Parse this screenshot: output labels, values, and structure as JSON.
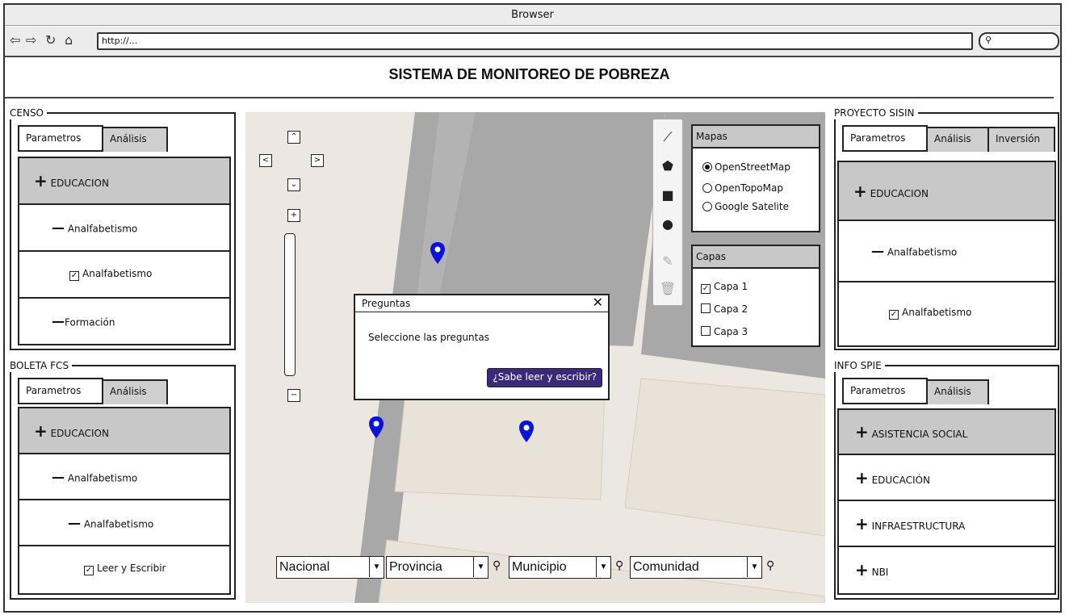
{
  "browser": {
    "title": "Browser",
    "url": "http://..."
  },
  "app_title": "SISTEMA DE MONITOREO DE POBREZA",
  "censo": {
    "label": "CENSO",
    "tabs": [
      "Parametros",
      "Análisis"
    ],
    "items": [
      "EDUCACION",
      "Analfabetismo",
      "Analfabetismo",
      "Formación"
    ]
  },
  "boleta": {
    "label": "BOLETA FCS",
    "tabs": [
      "Parametros",
      "Análisis"
    ],
    "items": [
      "EDUCACION",
      "Analfabetismo",
      "Analfabetismo",
      "Leer y Escribir"
    ]
  },
  "sisin": {
    "label": "PROYECTO SISIN",
    "tabs": [
      "Parametros",
      "Análisis",
      "Inversión"
    ],
    "items": [
      "EDUCACION",
      "Analfabetismo",
      "Analfabetismo"
    ]
  },
  "spie": {
    "label": "INFO SPIE",
    "tabs": [
      "Parametros",
      "Análisis"
    ],
    "items": [
      "ASISTENCIA SOCIAL",
      "EDUCACIÓN",
      "INFRAESTRUCTURA",
      "NBI"
    ]
  },
  "mapas": {
    "title": "Mapas",
    "options": [
      "OpenStreetMap",
      "OpenTopoMap",
      "Google Satelite"
    ],
    "selected": "OpenStreetMap"
  },
  "capas": {
    "title": "Capas",
    "layers": [
      {
        "label": "Capa 1",
        "checked": true
      },
      {
        "label": "Capa 2",
        "checked": false
      },
      {
        "label": "Capa 3",
        "checked": false
      }
    ]
  },
  "dialog": {
    "title": "Preguntas",
    "text": "Seleccione las preguntas",
    "button": "¿Sabe leer y escribir?"
  },
  "filters": [
    "Nacional",
    "Provincia",
    "Municipio",
    "Comunidad"
  ],
  "colors": {
    "pin": "#0a14d6",
    "button": "#3b2a7a",
    "selected_row": "#c8c8c8",
    "road": "#a8a8a8"
  }
}
